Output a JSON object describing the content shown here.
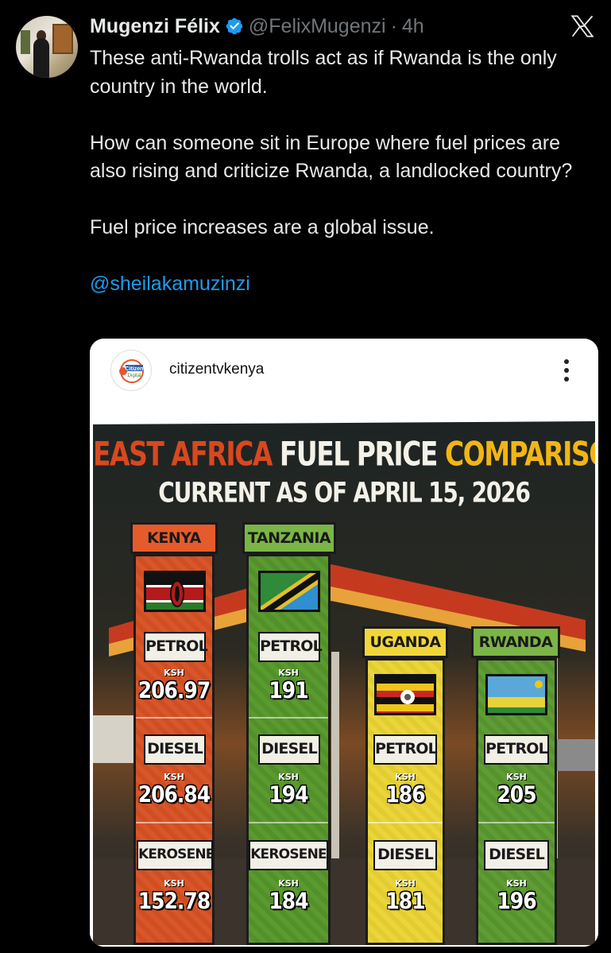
{
  "tweet": {
    "author_name": "Mugenzi Félix",
    "handle": "@FelixMugenzi",
    "separator": "·",
    "time": "4h",
    "paragraphs": [
      "These anti-Rwanda trolls act as if Rwanda is the only country in the world.",
      "How can someone sit in Europe where fuel prices are also rising and criticize Rwanda, a landlocked country?",
      "Fuel price increases are a global issue."
    ],
    "mention": "@sheilakamuzinzi"
  },
  "embed": {
    "account": "citizentvkenya",
    "logo_text_top": "Citizen",
    "logo_text_bottom": "Digital",
    "poster": {
      "title_part1": "EAST AFRICA",
      "title_part2": "FUEL PRICE",
      "title_part3": "COMPARISON",
      "subtitle": "CURRENT AS OF APRIL 15, 2026",
      "currency_label": "KSH",
      "countries": [
        {
          "name": "KENYA",
          "items": [
            {
              "fuel": "PETROL",
              "price": "206.97"
            },
            {
              "fuel": "DIESEL",
              "price": "206.84"
            },
            {
              "fuel": "KEROSENE",
              "price": "152.78"
            }
          ]
        },
        {
          "name": "TANZANIA",
          "items": [
            {
              "fuel": "PETROL",
              "price": "191"
            },
            {
              "fuel": "DIESEL",
              "price": "194"
            },
            {
              "fuel": "KEROSENE",
              "price": "184"
            }
          ]
        },
        {
          "name": "UGANDA",
          "items": [
            {
              "fuel": "PETROL",
              "price": "186"
            },
            {
              "fuel": "DIESEL",
              "price": "181"
            }
          ]
        },
        {
          "name": "RWANDA",
          "items": [
            {
              "fuel": "PETROL",
              "price": "205"
            },
            {
              "fuel": "DIESEL",
              "price": "196"
            }
          ]
        }
      ]
    }
  },
  "colors": {
    "background": "#000000",
    "text": "#e7e9ea",
    "muted": "#71767b",
    "link": "#1d9bf0",
    "kenya_column": "#d8562a",
    "tanzania_column": "#5a9a2e",
    "uganda_column": "#ead53a",
    "rwanda_column": "#5f9c34"
  },
  "icons": {
    "verified": "verified-badge-icon",
    "platform": "x-logo-icon",
    "more": "more-vertical-icon"
  }
}
